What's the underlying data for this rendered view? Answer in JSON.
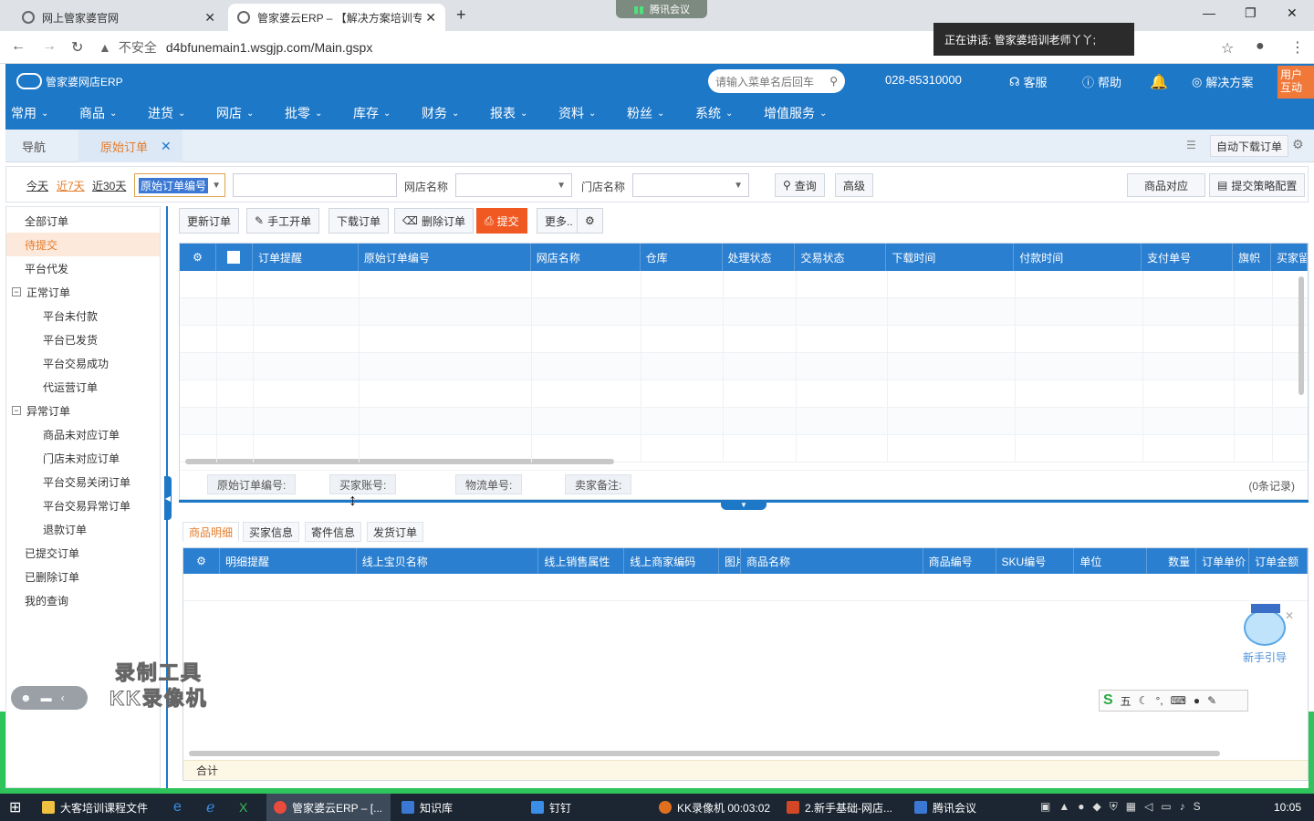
{
  "browser": {
    "tabs": [
      {
        "title": "网上管家婆官网",
        "active": false
      },
      {
        "title": "管家婆云ERP – 【解决方案培训专",
        "active": true
      }
    ],
    "new_tab": "+",
    "meeting_pill": "腾讯会议",
    "address": {
      "security": "不安全",
      "url": "d4bfunemain1.wsgjp.com/Main.gspx"
    },
    "speaking": "正在讲话: 管家婆培训老师丫丫;"
  },
  "app": {
    "logo": "管家婆网店ERP",
    "search_placeholder": "请输入菜单名后回车",
    "phone": "028-85310000",
    "service": "客服",
    "help": "帮助",
    "solutions": "解决方案",
    "user_interaction": "用户互动",
    "menu": [
      "常用",
      "商品",
      "进货",
      "网店",
      "批零",
      "库存",
      "财务",
      "报表",
      "资料",
      "粉丝",
      "系统",
      "增值服务"
    ]
  },
  "page_tabs": {
    "nav": "导航",
    "current": "原始订单",
    "auto_download": "自动下载订单"
  },
  "filter": {
    "today": "今天",
    "last7": "近7天",
    "last30": "近30天",
    "field_select": "原始订单编号",
    "shop_label": "网店名称",
    "store_label": "门店名称",
    "query": "查询",
    "advanced": "高级",
    "product_match": "商品对应",
    "strategy": "提交策略配置"
  },
  "left_nav": [
    {
      "label": "全部订单",
      "level": 0
    },
    {
      "label": "待提交",
      "level": 0,
      "active": true
    },
    {
      "label": "平台代发",
      "level": 0
    },
    {
      "label": "正常订单",
      "level": 0,
      "toggle": "−"
    },
    {
      "label": "平台未付款",
      "level": 1
    },
    {
      "label": "平台已发货",
      "level": 1
    },
    {
      "label": "平台交易成功",
      "level": 1
    },
    {
      "label": "代运营订单",
      "level": 1
    },
    {
      "label": "异常订单",
      "level": 0,
      "toggle": "−"
    },
    {
      "label": "商品未对应订单",
      "level": 1
    },
    {
      "label": "门店未对应订单",
      "level": 1
    },
    {
      "label": "平台交易关闭订单",
      "level": 1
    },
    {
      "label": "平台交易异常订单",
      "level": 1
    },
    {
      "label": "退款订单",
      "level": 1
    },
    {
      "label": "已提交订单",
      "level": 0
    },
    {
      "label": "已删除订单",
      "level": 0
    },
    {
      "label": "我的查询",
      "level": 0
    }
  ],
  "toolbar": {
    "refresh": "更新订单",
    "manual": "手工开单",
    "download": "下载订单",
    "delete": "删除订单",
    "submit": "提交",
    "more": "更多.."
  },
  "grid": {
    "columns": [
      "订单提醒",
      "原始订单编号",
      "网店名称",
      "仓库",
      "处理状态",
      "交易状态",
      "下载时间",
      "付款时间",
      "支付单号",
      "旗帜",
      "买家留"
    ],
    "footer_fields": [
      "原始订单编号:",
      "买家账号:",
      "物流单号:",
      "卖家备注:"
    ],
    "record_count": "(0条记录)"
  },
  "detail": {
    "tabs": [
      "商品明细",
      "买家信息",
      "寄件信息",
      "发货订单"
    ],
    "columns": [
      "明细提醒",
      "线上宝贝名称",
      "线上销售属性",
      "线上商家编码",
      "图片",
      "商品名称",
      "商品编号",
      "SKU编号",
      "单位",
      "数量",
      "订单单价",
      "订单金额"
    ],
    "total_label": "合计"
  },
  "overlays": {
    "guide": "新手引导",
    "ime": "五",
    "watermark_line1": "录制工具",
    "watermark_line2": "KK录像机"
  },
  "taskbar": {
    "items": [
      "大客培训课程文件",
      "管家婆云ERP – [...",
      "知识库",
      "钉钉",
      "KK录像机 00:03:02",
      "2.新手基础-网店...",
      "腾讯会议"
    ],
    "clock": "10:05"
  },
  "colors": {
    "primary": "#1e78c8",
    "accent": "#e47b2a",
    "submit": "#f05a22",
    "grid_header": "#2b7fd0"
  }
}
